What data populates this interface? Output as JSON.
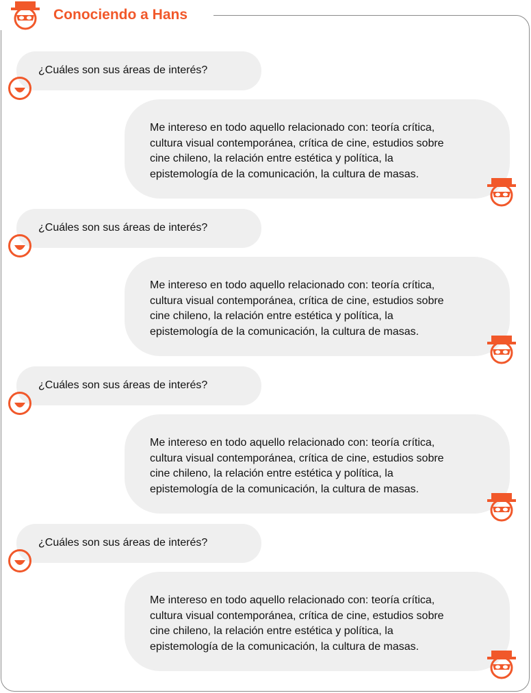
{
  "header": {
    "title": "Conociendo a Hans"
  },
  "icons": {
    "header": "hans-masked-hat-icon",
    "user": "smiling-face-icon",
    "hans": "hans-masked-hat-icon"
  },
  "colors": {
    "accent": "#f1582a",
    "bubble": "#efefef",
    "frame_border": "#8a8a8a",
    "text": "#111111"
  },
  "conversation": [
    {
      "question": "¿Cuáles son sus áreas de interés?",
      "answer": "Me intereso en todo aquello relacionado con: teoría crítica,\ncultura visual contemporánea, crítica de cine, estudios sobre\ncine chileno, la relación entre estética y política, la\nepistemología de la comunicación, la cultura de masas."
    },
    {
      "question": "¿Cuáles son sus áreas de interés?",
      "answer": "Me intereso en todo aquello relacionado con: teoría crítica,\ncultura visual contemporánea, crítica de cine, estudios sobre\ncine chileno, la relación entre estética y política, la\nepistemología de la comunicación, la cultura de masas."
    },
    {
      "question": "¿Cuáles son sus áreas de interés?",
      "answer": "Me intereso en todo aquello relacionado con: teoría crítica,\ncultura visual contemporánea, crítica de cine, estudios sobre\ncine chileno, la relación entre estética y política, la\nepistemología de la comunicación, la cultura de masas."
    },
    {
      "question": "¿Cuáles son sus áreas de interés?",
      "answer": "Me intereso en todo aquello relacionado con: teoría crítica,\ncultura visual contemporánea, crítica de cine, estudios sobre\ncine chileno, la relación entre estética y política, la\nepistemología de la comunicación, la cultura de masas."
    }
  ]
}
